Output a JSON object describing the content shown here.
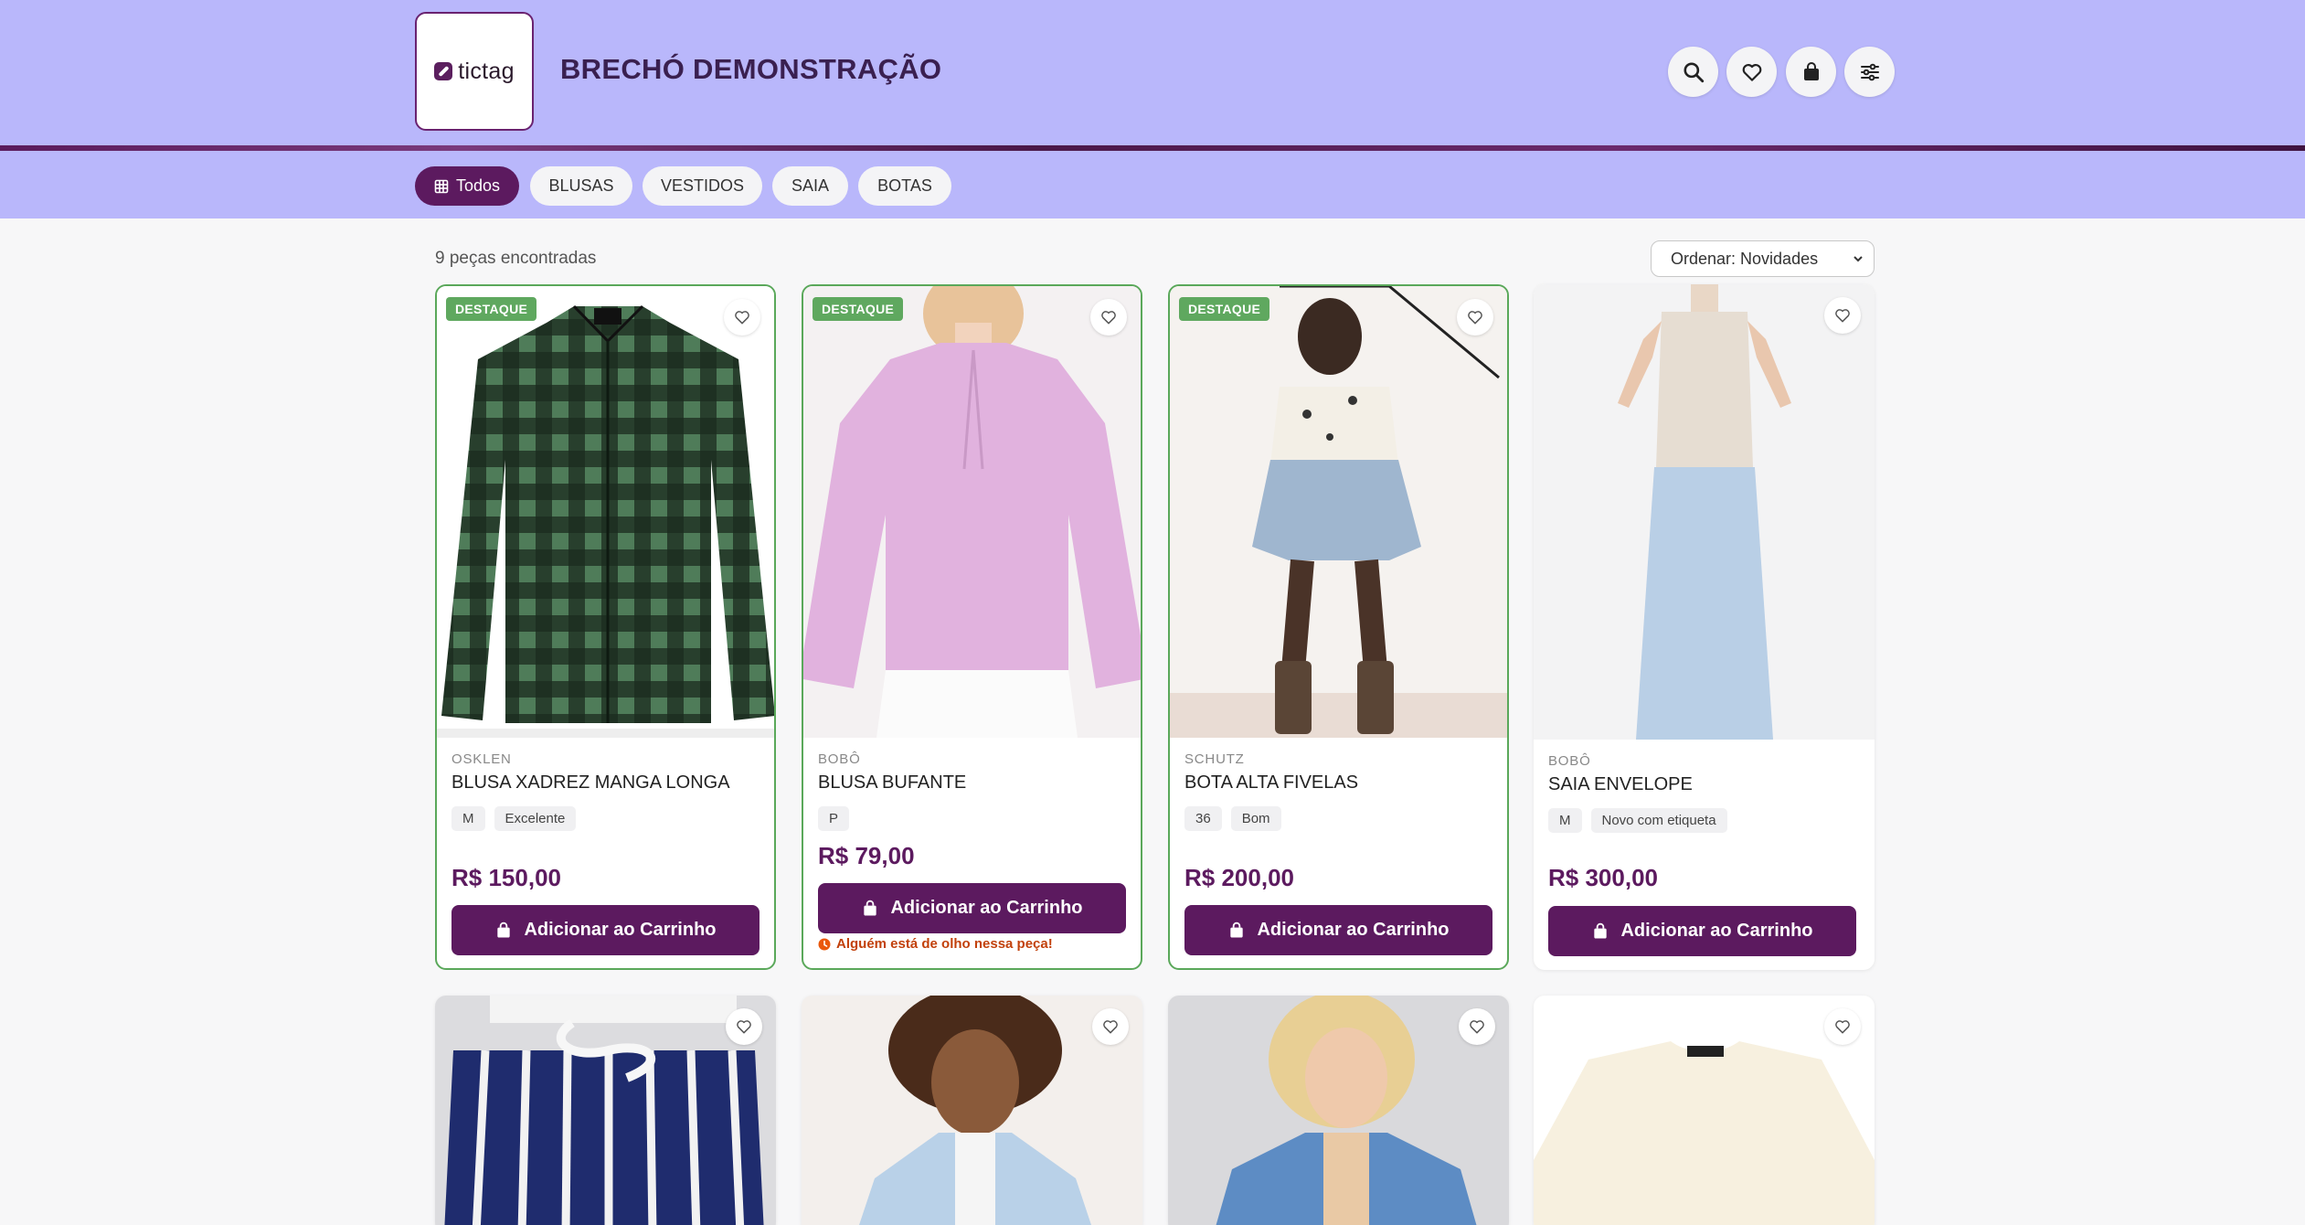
{
  "header": {
    "logo_text": "tictag",
    "store_title": "BRECHÓ DEMONSTRAÇÃO",
    "icons": [
      "search-icon",
      "heart-icon",
      "bag-icon",
      "sliders-icon"
    ]
  },
  "categories": [
    {
      "label": "Todos",
      "active": true,
      "icon": "grid-icon"
    },
    {
      "label": "BLUSAS",
      "active": false
    },
    {
      "label": "VESTIDOS",
      "active": false
    },
    {
      "label": "SAIA",
      "active": false
    },
    {
      "label": "BOTAS",
      "active": false
    }
  ],
  "results": {
    "count_text": "9 peças encontradas",
    "sort_value": "Ordenar: Novidades"
  },
  "products": [
    {
      "badge": "DESTAQUE",
      "brand": "OSKLEN",
      "name": "BLUSA XADREZ MANGA LONGA",
      "tags": [
        "M",
        "Excelente"
      ],
      "price": "R$ 150,00",
      "button": "Adicionar ao Carrinho",
      "alert": ""
    },
    {
      "badge": "DESTAQUE",
      "brand": "BOBÔ",
      "name": "BLUSA BUFANTE",
      "tags": [
        "P"
      ],
      "price": "R$ 79,00",
      "button": "Adicionar ao Carrinho",
      "alert": "Alguém está de olho nessa peça!"
    },
    {
      "badge": "DESTAQUE",
      "brand": "SCHUTZ",
      "name": "BOTA ALTA FIVELAS",
      "tags": [
        "36",
        "Bom"
      ],
      "price": "R$ 200,00",
      "button": "Adicionar ao Carrinho",
      "alert": ""
    },
    {
      "badge": "",
      "brand": "BOBÔ",
      "name": "SAIA ENVELOPE",
      "tags": [
        "M",
        "Novo com etiqueta"
      ],
      "price": "R$ 300,00",
      "button": "Adicionar ao Carrinho",
      "alert": ""
    }
  ],
  "colors": {
    "header_bg": "#b9b7fb",
    "accent": "#5c1a5f",
    "featured_border": "#5aa85a",
    "alert": "#c2410c"
  }
}
